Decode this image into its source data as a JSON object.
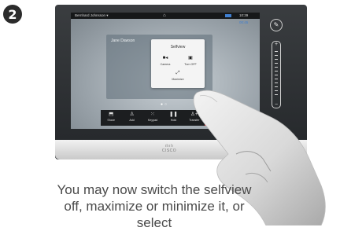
{
  "step": {
    "number": "2"
  },
  "statusbar": {
    "caller": "Bernhard Johnsson  ▾",
    "clock": "10:39"
  },
  "call": {
    "duration": "00:45"
  },
  "participant": {
    "name": "Jane Dawson"
  },
  "popup": {
    "title": "Selfview",
    "options": [
      {
        "label": "Camera",
        "icon": "video-camera-icon"
      },
      {
        "label": "Turn OFF",
        "icon": "person-off-icon"
      },
      {
        "label": "Maximize",
        "icon": "expand-arrows-icon"
      }
    ]
  },
  "toolbar": {
    "items": [
      {
        "label": "Share",
        "icon": "share-icon"
      },
      {
        "label": "Add",
        "icon": "add-person-icon"
      },
      {
        "label": "Keypad",
        "icon": "keypad-icon"
      },
      {
        "label": "Hold",
        "icon": "pause-icon"
      },
      {
        "label": "Transfer",
        "icon": "transfer-icon"
      }
    ],
    "end_call_color": "#d52a2a"
  },
  "device": {
    "brand": "ılıılı\nCISCO"
  },
  "caption": "You may now switch the selfview off, maximize or minimize it, or select"
}
